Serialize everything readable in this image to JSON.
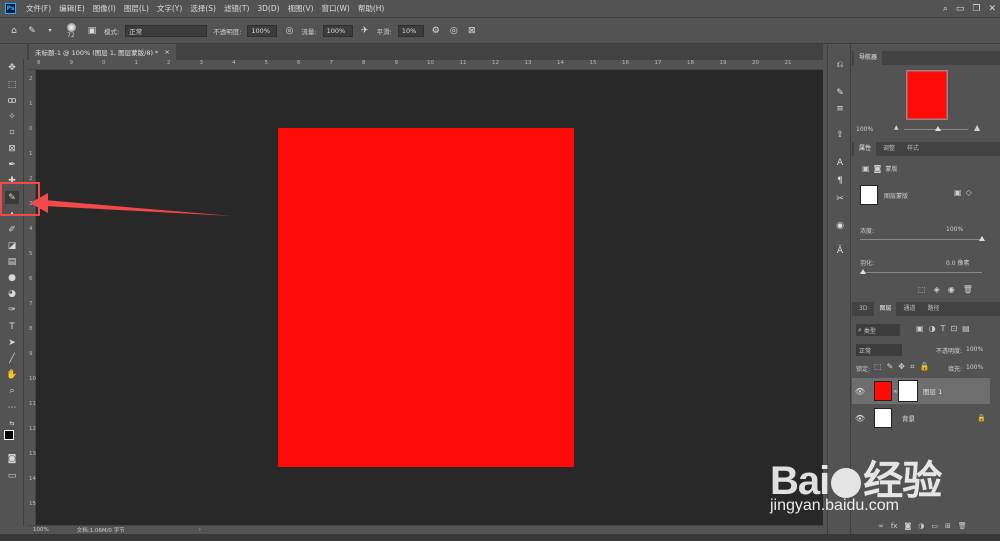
{
  "menubar": {
    "app_logo": "Ps",
    "items": [
      "文件(F)",
      "编辑(E)",
      "图像(I)",
      "图层(L)",
      "文字(Y)",
      "选择(S)",
      "滤镜(T)",
      "3D(D)",
      "视图(V)",
      "窗口(W)",
      "帮助(H)"
    ],
    "icons": [
      "search-icon",
      "window-icon",
      "restore-icon",
      "close-icon"
    ]
  },
  "options_bar": {
    "brush_size": "72",
    "mode_label": "模式:",
    "mode_value": "正常",
    "opacity_label": "不透明度:",
    "opacity_value": "100%",
    "flow_label": "流量:",
    "flow_value": "100%",
    "smoothing_label": "平滑:",
    "smoothing_value": "10%"
  },
  "document": {
    "tab_title": "未标题-1 @ 100% (图层 1, 图层蒙版/8) *",
    "close": "×",
    "canvas_color": "#ff0c08",
    "zoom": "100%",
    "status": "文档:1.06M/0 字节",
    "status_arrow": "›"
  },
  "rulers": {
    "h": [
      "8",
      "9",
      "0",
      "1",
      "2",
      "3",
      "4",
      "5",
      "6",
      "7",
      "8",
      "9",
      "10",
      "11",
      "12",
      "13",
      "14",
      "15",
      "16",
      "17",
      "18",
      "19",
      "20",
      "21"
    ],
    "v": [
      "2",
      "1",
      "0",
      "1",
      "2",
      "3",
      "4",
      "5",
      "6",
      "7",
      "8",
      "9",
      "10",
      "11",
      "12",
      "13",
      "14",
      "15"
    ]
  },
  "navigator": {
    "tab": "导航器",
    "zoom": "100%",
    "thumb_color": "#ff0c08"
  },
  "properties": {
    "tabs": [
      "属性",
      "调整",
      "样式"
    ],
    "section_label": "蒙版",
    "mask_label": "图层蒙版",
    "density_label": "浓度:",
    "density_value": "100%",
    "density_fraction": 1.0,
    "feather_label": "羽化:",
    "feather_value": "0.0 像素",
    "feather_fraction": 0.0
  },
  "layers": {
    "tabs": [
      "3D",
      "图层",
      "通道",
      "路径"
    ],
    "filter_label": "类型",
    "blend_mode": "正常",
    "opacity_label": "不透明度:",
    "opacity_value": "100%",
    "lock_label": "锁定:",
    "fill_label": "填充:",
    "fill_value": "100%",
    "items": [
      {
        "name": "图层 1",
        "thumb": "#ff0c08",
        "selected": true
      },
      {
        "name": "背景",
        "thumb": "#ffffff",
        "selected": false
      }
    ],
    "footer_icons": [
      "link-icon",
      "fx-icon",
      "mask-icon",
      "adjustment-icon",
      "group-icon",
      "new-layer-icon",
      "delete-icon"
    ]
  },
  "annotation": {
    "highlight_color": "#f2494b"
  },
  "watermark": {
    "brand": "Bai",
    "brand_suffix": "经验",
    "url": "jingyan.baidu.com"
  }
}
